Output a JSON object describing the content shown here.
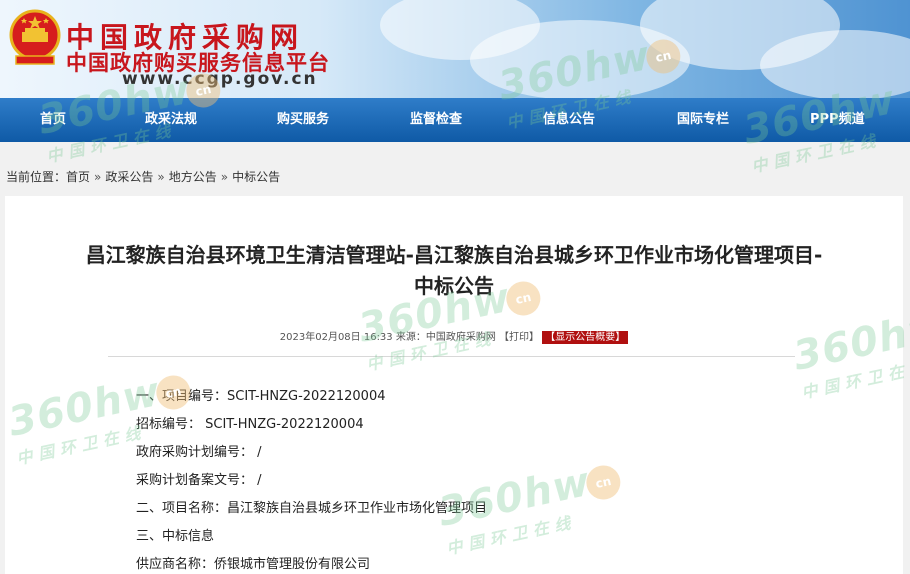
{
  "header": {
    "title": "中国政府采购网",
    "subtitle": "中国政府购买服务信息平台",
    "url": "www.ccgp.gov.cn",
    "emblem_icon": "national-emblem-icon"
  },
  "nav": {
    "items": [
      "首页",
      "政采法规",
      "购买服务",
      "监督检查",
      "信息公告",
      "国际专栏",
      "PPP频道"
    ]
  },
  "breadcrumb": {
    "label": "当前位置：",
    "items": [
      "首页",
      "政采公告",
      "地方公告",
      "中标公告"
    ],
    "separator": "»"
  },
  "article": {
    "title_line1": "昌江黎族自治县环境卫生清洁管理站-昌江黎族自治县城乡环卫作业市场化管理项目-",
    "title_line2": "中标公告",
    "meta_date": "2023年02月08日 16:33",
    "meta_source": "来源：中国政府采购网",
    "meta_print": "【打印】",
    "meta_summary": "【显示公告概要】",
    "lines": [
      "一、项目编号：SCIT-HNZG-2022120004",
      "招标编号： SCIT-HNZG-2022120004",
      "政府采购计划编号： /",
      "采购计划备案文号： /",
      "二、项目名称：昌江黎族自治县城乡环卫作业市场化管理项目",
      "三、中标信息",
      "供应商名称：侨银城市管理股份有限公司"
    ]
  },
  "watermark": {
    "brand": "360hw",
    "tagline": "中国环卫在线",
    "badge": "cn"
  },
  "colors": {
    "brand_red": "#c8161d",
    "nav_blue": "#1565b4",
    "badge_red": "#b00f0f"
  }
}
